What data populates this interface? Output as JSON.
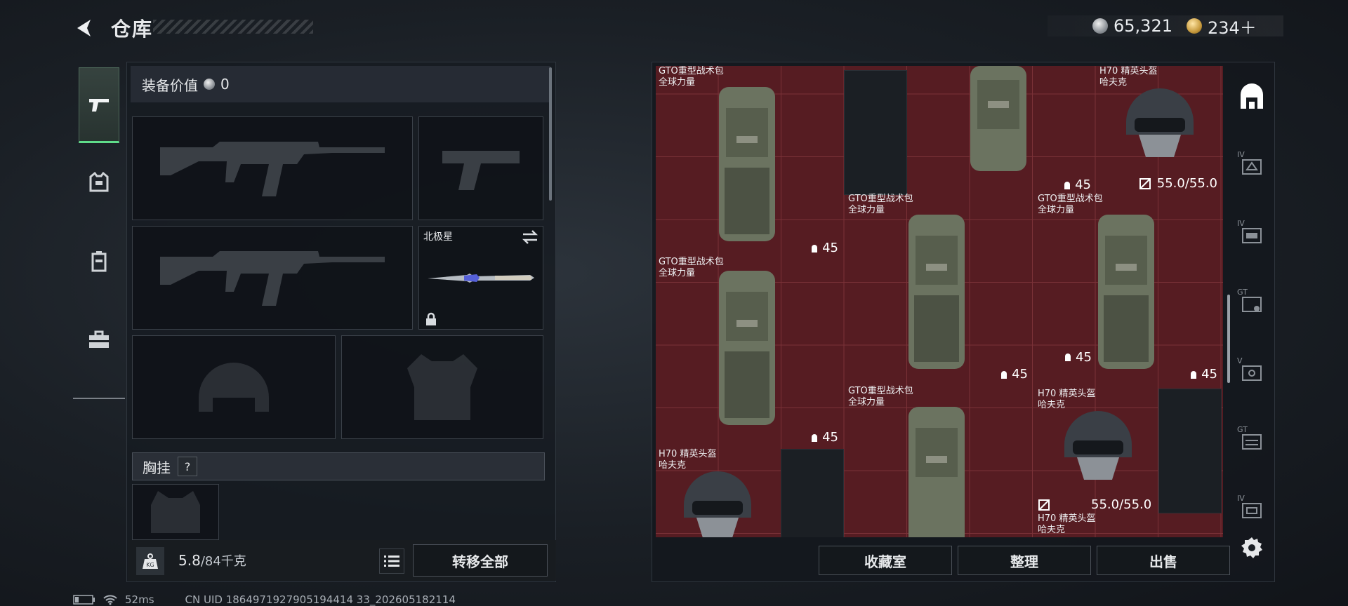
{
  "header": {
    "title": "仓库",
    "currency_silver": "65,321",
    "currency_gold": "234＋"
  },
  "equipment": {
    "value_label": "装备价值",
    "value": "0",
    "melee_name": "北极星",
    "chest_rig_label": "胸挂",
    "help": "?"
  },
  "weight": {
    "kg_icon": "KG",
    "current": "5.8",
    "max": "/84千克",
    "transfer_all": "转移全部"
  },
  "status": {
    "ping": "52ms",
    "uid": "CN UID 1864971927905194414 33_202605182114"
  },
  "storage": {
    "items": [
      {
        "name": "GTO重型战术包",
        "sub": "全球力量",
        "qty": "45",
        "kind": "backpack"
      },
      {
        "name": "",
        "sub": "",
        "qty": "45",
        "kind": "backpack"
      },
      {
        "name": "H70 精英头盔",
        "sub": "哈夫克",
        "dur": "55.0/55.0",
        "kind": "helmet"
      },
      {
        "name": "GTO重型战术包",
        "sub": "全球力量",
        "qty": "45",
        "kind": "backpack"
      },
      {
        "name": "GTO重型战术包",
        "sub": "全球力量",
        "qty": "45",
        "kind": "backpack"
      },
      {
        "name": "GTO重型战术包",
        "sub": "全球力量",
        "qty": "45",
        "kind": "backpack"
      },
      {
        "name": "GTO重型战术包",
        "sub": "全球力量",
        "qty": "",
        "kind": "backpack"
      },
      {
        "name": "H70 精英头盔",
        "sub": "哈夫克",
        "dur": "55.0/55.0",
        "kind": "helmet"
      },
      {
        "name": "H70 精英头盔",
        "sub": "哈夫克",
        "dur": "",
        "kind": "helmet"
      },
      {
        "name": "H70 精英头盔",
        "sub": "哈夫克",
        "dur": "",
        "kind": "helmet"
      }
    ],
    "buttons": {
      "collection": "收藏室",
      "organize": "整理",
      "sell": "出售"
    },
    "rail": [
      "IV",
      "IV",
      "GT",
      "V",
      "GT",
      "IV"
    ]
  },
  "colors": {
    "grid_bg": "#561c22",
    "tab_active": "#5fdc8a"
  },
  "icons": [
    "back-arrow-icon",
    "pistol-icon",
    "armor-icon",
    "backpack-icon",
    "toolbox-icon",
    "lock-icon",
    "swap-icon",
    "list-icon",
    "weight-icon",
    "gear-icon",
    "storage-home-icon",
    "durability-icon",
    "battery-icon",
    "wifi-icon"
  ]
}
